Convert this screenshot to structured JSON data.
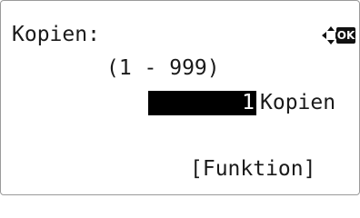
{
  "screen": {
    "title": "Kopien:",
    "range": "(1 - 999)",
    "value": "1",
    "unit": "Kopien",
    "softkey_label": "[Funktion]",
    "ok_label": "OK",
    "nav_icon": "four-way-arrow-icon"
  }
}
